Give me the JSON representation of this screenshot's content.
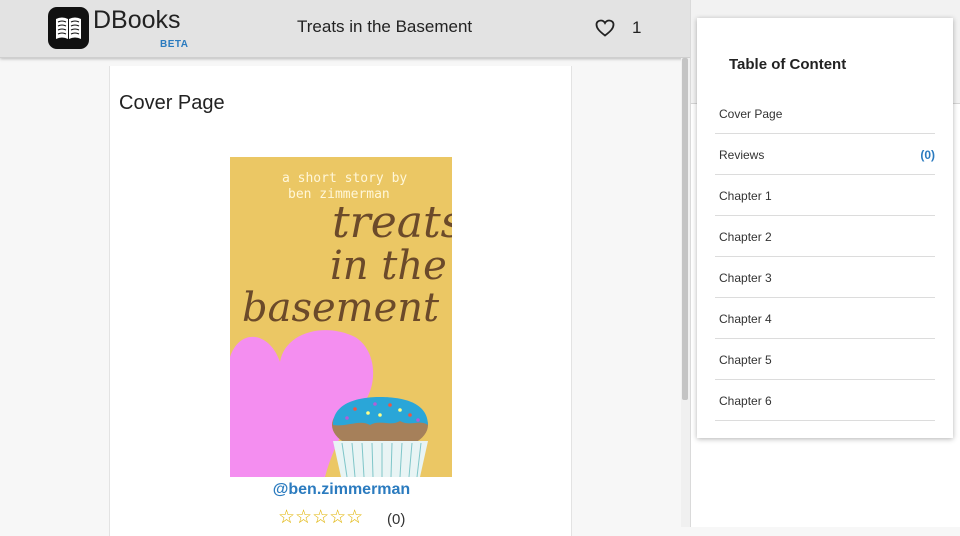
{
  "header": {
    "brand": "DBooks",
    "beta": "BETA",
    "book_title": "Treats in the Basement",
    "like_count": "1"
  },
  "content": {
    "section_title": "Cover Page",
    "cover_lines": {
      "subtitle1": "a short story by",
      "subtitle2": "ben zimmerman",
      "title1": "treats",
      "title2": "in the",
      "title3": "basement"
    },
    "author": "@ben.zimmerman",
    "stars": "☆☆☆☆☆",
    "rating_count": "(0)"
  },
  "toc": {
    "title": "Table of Content",
    "items": [
      {
        "label": "Cover Page",
        "badge": ""
      },
      {
        "label": "Reviews",
        "badge": "(0)"
      },
      {
        "label": "Chapter 1",
        "badge": ""
      },
      {
        "label": "Chapter 2",
        "badge": ""
      },
      {
        "label": "Chapter 3",
        "badge": ""
      },
      {
        "label": "Chapter 4",
        "badge": ""
      },
      {
        "label": "Chapter 5",
        "badge": ""
      },
      {
        "label": "Chapter 6",
        "badge": ""
      }
    ]
  },
  "colors": {
    "accent": "#2b7bbf",
    "cover_bg": "#ebc764",
    "heart_pink": "#f48ef0",
    "cupcake_frosting": "#2aa6d8"
  },
  "icons": {
    "logo": "open-book-icon",
    "like": "heart-icon",
    "rating": "star-icon"
  }
}
